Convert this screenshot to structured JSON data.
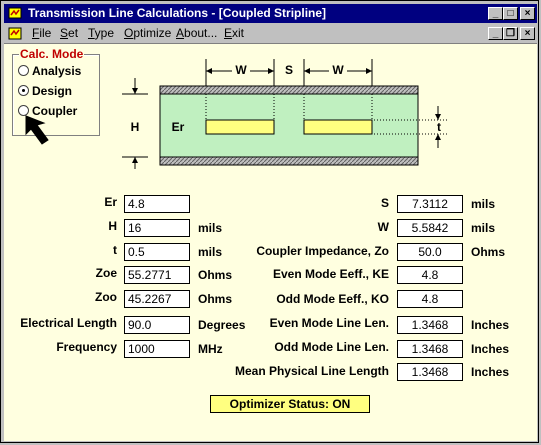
{
  "window": {
    "title": "Transmission Line Calculations - [Coupled Stripline]"
  },
  "menu": [
    {
      "label": "File",
      "u": "F",
      "rest": "ile"
    },
    {
      "label": "Set",
      "u": "S",
      "rest": "et"
    },
    {
      "label": "Type",
      "u": "T",
      "rest": "ype"
    },
    {
      "label": "Optimize",
      "u": "O",
      "rest": "ptimize"
    },
    {
      "label": "About...",
      "u": "A",
      "rest": "bout..."
    },
    {
      "label": "Exit",
      "u": "E",
      "rest": "xit"
    }
  ],
  "calc_mode": {
    "title": "Calc. Mode",
    "options": [
      "Analysis",
      "Design",
      "Coupler"
    ],
    "selected": "Design"
  },
  "diagram": {
    "w1": "W",
    "s": "S",
    "w2": "W",
    "h": "H",
    "er": "Er",
    "t": "t"
  },
  "left_fields": [
    {
      "label": "Er",
      "value": "4.8",
      "unit": ""
    },
    {
      "label": "H",
      "value": "16",
      "unit": "mils"
    },
    {
      "label": "t",
      "value": "0.5",
      "unit": "mils"
    },
    {
      "label": "Zoe",
      "value": "55.2771",
      "unit": "Ohms"
    },
    {
      "label": "Zoo",
      "value": "45.2267",
      "unit": "Ohms"
    },
    {
      "label": "Electrical Length",
      "value": "90.0",
      "unit": "Degrees"
    },
    {
      "label": "Frequency",
      "value": "1000",
      "unit": "MHz"
    }
  ],
  "right_fields": [
    {
      "label": "S",
      "value": "7.3112",
      "unit": "mils"
    },
    {
      "label": "W",
      "value": "5.5842",
      "unit": "mils"
    },
    {
      "label": "Coupler Impedance, Zo",
      "value": "50.0",
      "unit": "Ohms"
    },
    {
      "label": "Even Mode Eeff., KE",
      "value": "4.8",
      "unit": ""
    },
    {
      "label": "Odd Mode Eeff., KO",
      "value": "4.8",
      "unit": ""
    },
    {
      "label": "Even Mode Line Len.",
      "value": "1.3468",
      "unit": "Inches"
    },
    {
      "label": "Odd Mode Line Len.",
      "value": "1.3468",
      "unit": "Inches"
    },
    {
      "label": "Mean Physical Line Length",
      "value": "1.3468",
      "unit": "Inches"
    }
  ],
  "status": "Optimizer Status: ON",
  "colors": {
    "title_bar": "#000080",
    "substrate": "#c0f0c0",
    "strip": "#ffff80",
    "client_bg": "#ffffe0",
    "group_title": "#c00000"
  }
}
